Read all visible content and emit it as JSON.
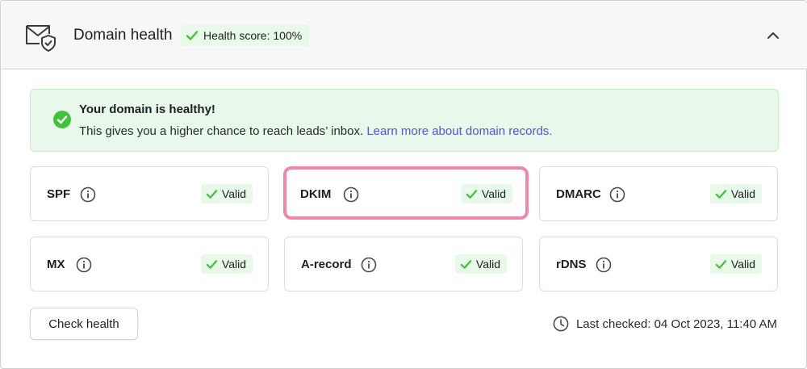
{
  "header": {
    "title": "Domain health",
    "score_label": "Health score: 100%",
    "icon": "mail-shield-icon",
    "collapse_icon": "chevron-up-icon"
  },
  "banner": {
    "title": "Your domain is healthy!",
    "text": "This gives you a higher chance to reach leads’ inbox. ",
    "link": "Learn more about domain records."
  },
  "records": [
    {
      "name": "SPF",
      "status": "Valid"
    },
    {
      "name": "DKIM",
      "status": "Valid",
      "highlighted": true
    },
    {
      "name": "DMARC",
      "status": "Valid"
    },
    {
      "name": "MX",
      "status": "Valid"
    },
    {
      "name": "A-record",
      "status": "Valid"
    },
    {
      "name": "rDNS",
      "status": "Valid"
    }
  ],
  "footer": {
    "check_button": "Check health",
    "last_checked": "Last checked: 04 Oct 2023, 11:40 AM"
  },
  "colors": {
    "success": "#44c13c",
    "badge_bg": "#e8f8e9",
    "highlight": "#f186a8",
    "link": "#5b52d6"
  }
}
